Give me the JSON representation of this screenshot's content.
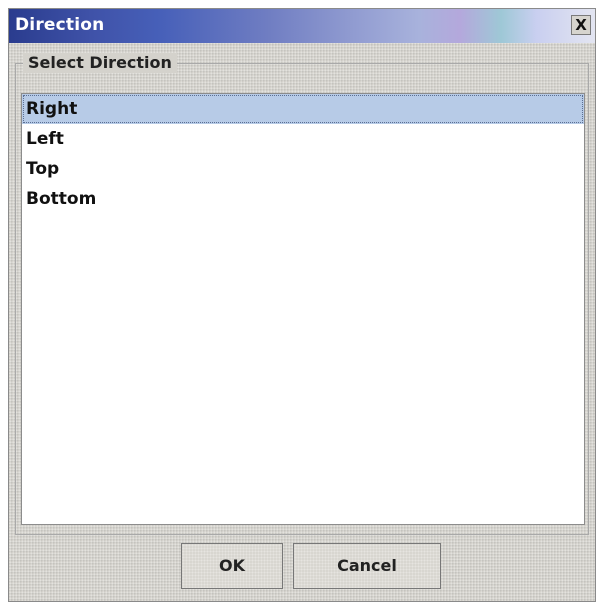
{
  "window": {
    "title": "Direction",
    "close_label": "X"
  },
  "group": {
    "label": "Select Direction"
  },
  "list": {
    "items": [
      "Right",
      "Left",
      "Top",
      "Bottom"
    ],
    "selected": "Right"
  },
  "buttons": {
    "ok_label": "OK",
    "cancel_label": "Cancel"
  },
  "colors": {
    "titlebar_accent": "#3f52a8",
    "selection": "#b7cbe7"
  }
}
